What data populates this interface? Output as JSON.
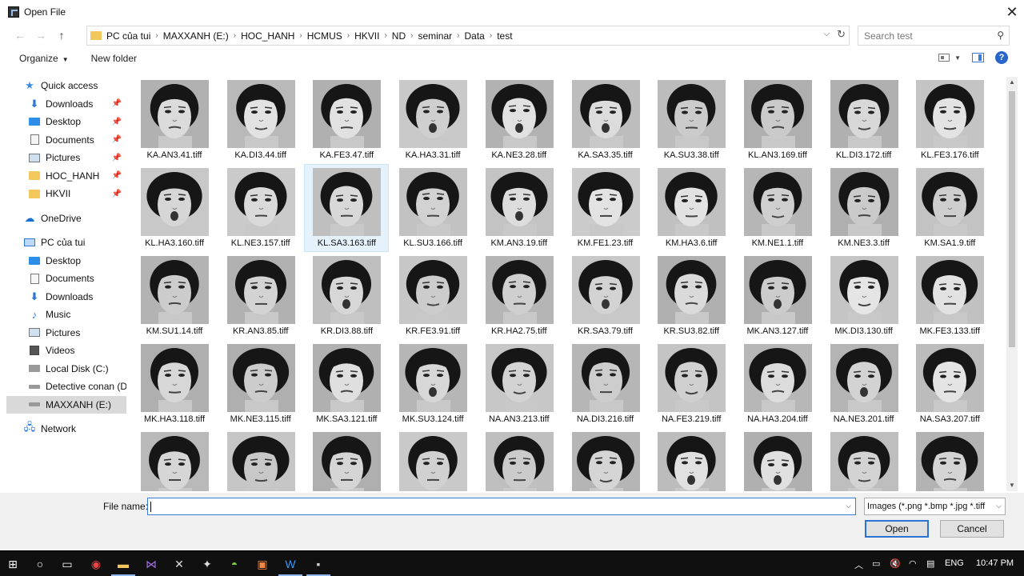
{
  "window": {
    "title": "Open File"
  },
  "address": {
    "crumbs": [
      "PC của tui",
      "MAXXANH (E:)",
      "HOC_HANH",
      "HCMUS",
      "HKVII",
      "ND",
      "seminar",
      "Data",
      "test"
    ],
    "search_placeholder": "Search test"
  },
  "toolbar": {
    "organize": "Organize",
    "new_folder": "New folder"
  },
  "nav": {
    "quick_access": "Quick access",
    "qa_items": [
      "Downloads",
      "Desktop",
      "Documents",
      "Pictures",
      "HOC_HANH",
      "HKVII"
    ],
    "onedrive": "OneDrive",
    "pc": "PC của tui",
    "pc_items": [
      "Desktop",
      "Documents",
      "Downloads",
      "Music",
      "Pictures",
      "Videos",
      "Local Disk (C:)",
      "Detective conan (D:",
      "MAXXANH (E:)"
    ],
    "network": "Network"
  },
  "files": [
    "KA.AN3.41.tiff",
    "KA.DI3.44.tiff",
    "KA.FE3.47.tiff",
    "KA.HA3.31.tiff",
    "KA.NE3.28.tiff",
    "KA.SA3.35.tiff",
    "KA.SU3.38.tiff",
    "KL.AN3.169.tiff",
    "KL.DI3.172.tiff",
    "KL.FE3.176.tiff",
    "KL.HA3.160.tiff",
    "KL.NE3.157.tiff",
    "KL.SA3.163.tiff",
    "KL.SU3.166.tiff",
    "KM.AN3.19.tiff",
    "KM.FE1.23.tiff",
    "KM.HA3.6.tiff",
    "KM.NE1.1.tiff",
    "KM.NE3.3.tiff",
    "KM.SA1.9.tiff",
    "KM.SU1.14.tiff",
    "KR.AN3.85.tiff",
    "KR.DI3.88.tiff",
    "KR.FE3.91.tiff",
    "KR.HA2.75.tiff",
    "KR.SA3.79.tiff",
    "KR.SU3.82.tiff",
    "MK.AN3.127.tiff",
    "MK.DI3.130.tiff",
    "MK.FE3.133.tiff",
    "MK.HA3.118.tiff",
    "MK.NE3.115.tiff",
    "MK.SA3.121.tiff",
    "MK.SU3.124.tiff",
    "NA.AN3.213.tiff",
    "NA.DI3.216.tiff",
    "NA.FE3.219.tiff",
    "NA.HA3.204.tiff",
    "NA.NE3.201.tiff",
    "NA.SA3.207.tiff",
    "",
    "",
    "",
    "",
    "",
    "",
    "",
    "",
    "",
    ""
  ],
  "bottom": {
    "file_name_label": "File name:",
    "file_name_value": "",
    "filter": "Images (*.png *.bmp *.jpg *.tiff",
    "open": "Open",
    "cancel": "Cancel"
  },
  "taskbar": {
    "lang": "ENG",
    "time": "10:47 PM"
  }
}
